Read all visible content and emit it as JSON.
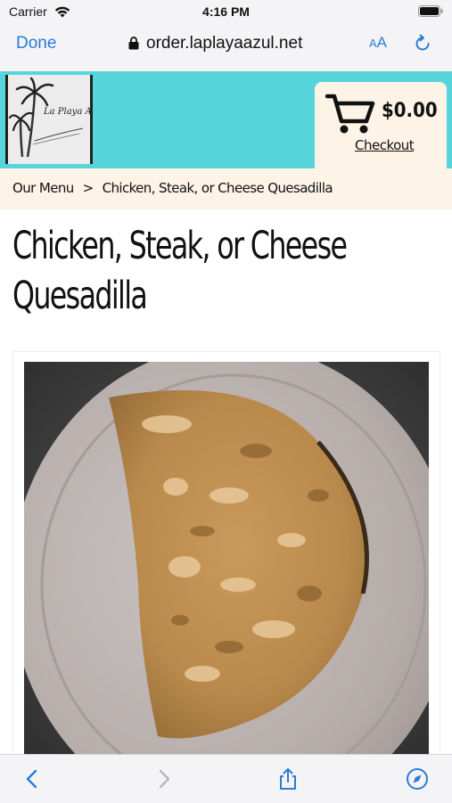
{
  "status_bar": {
    "carrier": "Carrier",
    "time": "4:16 PM"
  },
  "browser": {
    "done_label": "Done",
    "url": "order.laplayaazul.net",
    "text_size_label_small": "A",
    "text_size_label_large": "A"
  },
  "header": {
    "logo_text": "La Playa Azul",
    "cart_total": "$0.00",
    "checkout_label": "Checkout"
  },
  "breadcrumb": {
    "home": "Our Menu",
    "separator": ">",
    "current": "Chicken, Steak, or Cheese Quesadilla"
  },
  "product": {
    "title": "Chicken, Steak, or Cheese Quesadilla",
    "image_subject": "quesadilla on plate"
  },
  "colors": {
    "accent_blue": "#2a7bd9",
    "header_teal": "#56d6dc",
    "cream": "#fdf3e7"
  },
  "icons": {
    "wifi": "wifi-icon",
    "battery": "battery-icon",
    "lock": "lock-icon",
    "reload": "reload-icon",
    "cart": "cart-icon",
    "back": "back-icon",
    "forward": "forward-icon",
    "share": "share-icon",
    "compass": "compass-icon"
  }
}
